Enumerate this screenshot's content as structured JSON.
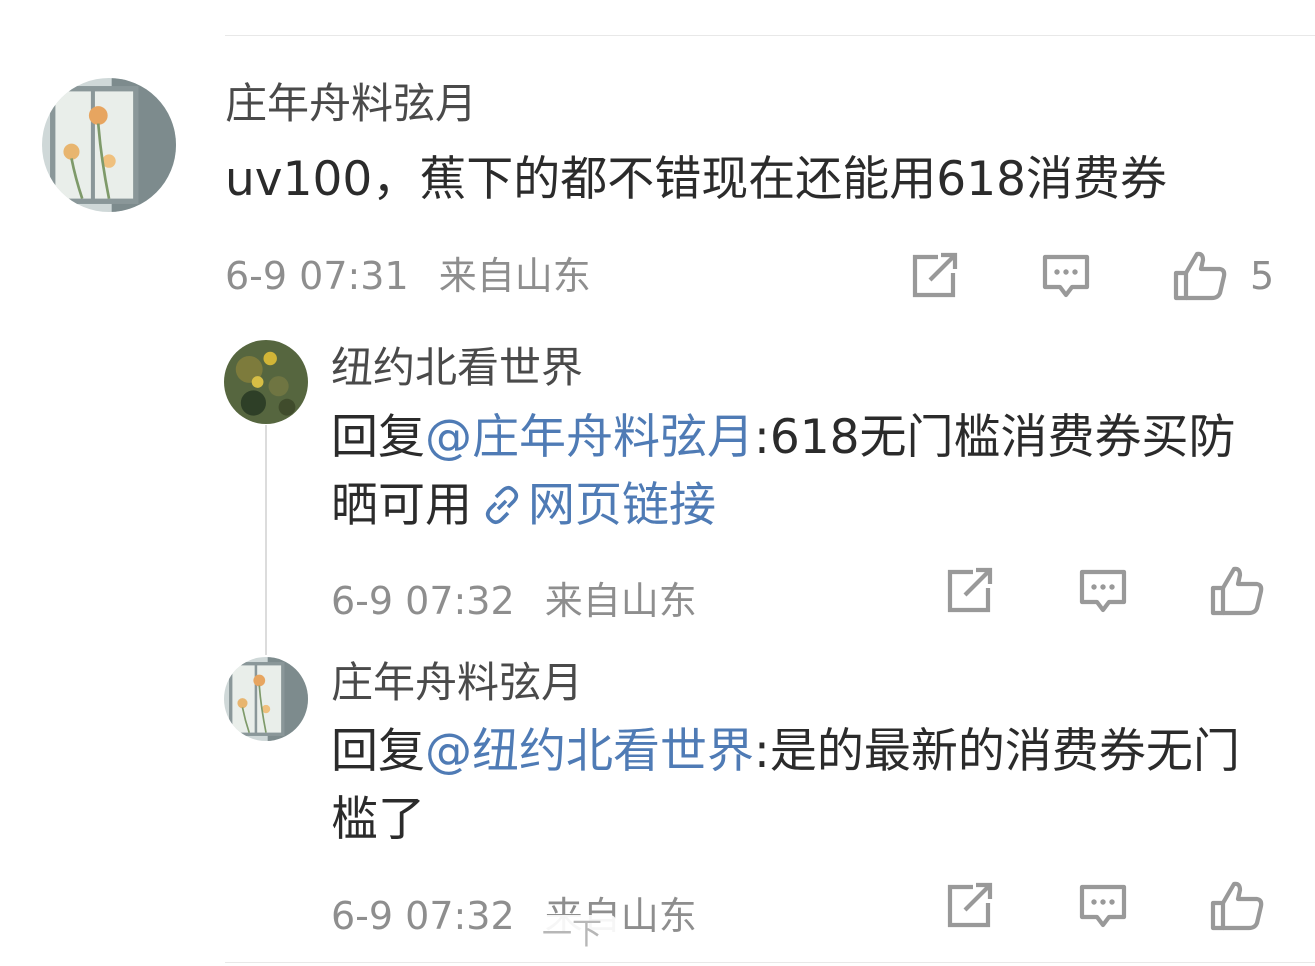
{
  "comments": [
    {
      "user": "庄年舟料弦月",
      "text": "uv100，蕉下的都不错现在还能用618消费券",
      "time": "6-9 07:31",
      "location": "来自山东",
      "likes": "5"
    }
  ],
  "replies": [
    {
      "user": "纽约北看世界",
      "prefix": "回复",
      "mention": "@庄年舟料弦月",
      "text": ":618无门槛消费券买防晒可用",
      "link_icon": "link-icon",
      "link_text": "网页链接",
      "time": "6-9 07:32",
      "location": "来自山东"
    },
    {
      "user": "庄年舟料弦月",
      "prefix": "回复",
      "mention": "@纽约北看世界",
      "text": ":是的最新的消费券无门槛了",
      "time": "6-9 07:32",
      "location": "来自山东"
    }
  ],
  "overlay": {
    "text": "一下"
  },
  "icons": {
    "share": "share-icon",
    "comment": "comment-icon",
    "like": "like-icon"
  }
}
